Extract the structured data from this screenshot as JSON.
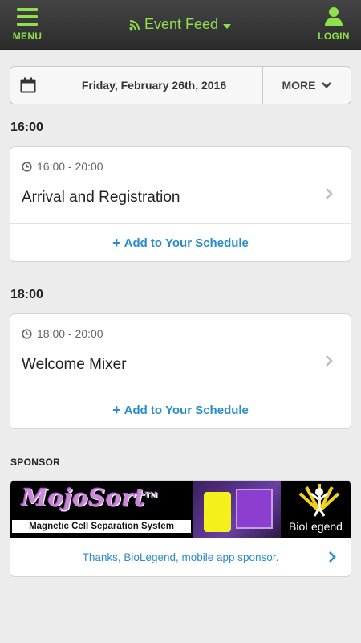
{
  "header": {
    "menu_label": "MENU",
    "title": "Event Feed",
    "login_label": "LOGIN"
  },
  "datebar": {
    "date": "Friday, February 26th, 2016",
    "more_label": "MORE"
  },
  "sessions": [
    {
      "heading": "16:00",
      "time_range": "16:00 - 20:00",
      "name": "Arrival and Registration",
      "action": "Add to Your Schedule"
    },
    {
      "heading": "18:00",
      "time_range": "18:00 - 20:00",
      "name": "Welcome Mixer",
      "action": "Add to Your Schedule"
    }
  ],
  "sponsor": {
    "label": "SPONSOR",
    "banner_brand": "MojoSort",
    "banner_trademark": "TM",
    "banner_tagline": "Magnetic Cell Separation System",
    "banner_company": "BioLegend",
    "link_text": "Thanks, BioLegend, mobile app sponsor."
  },
  "colors": {
    "accent_green": "#8ee04c",
    "link_blue": "#2b8dcc",
    "topbar": "#333333"
  },
  "icons": {
    "menu": "hamburger-icon",
    "feed": "rss-icon",
    "dropdown": "caret-down-icon",
    "login": "user-icon",
    "calendar": "calendar-icon",
    "more": "chevron-down-icon",
    "clock": "clock-icon",
    "row": "chevron-right-icon",
    "add": "plus-icon"
  }
}
